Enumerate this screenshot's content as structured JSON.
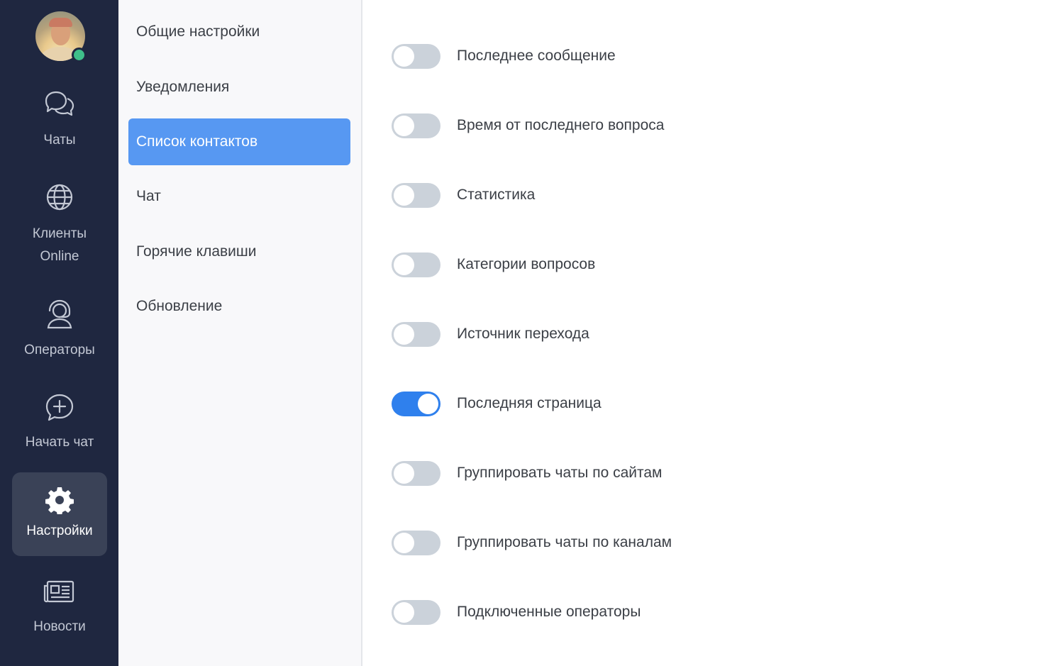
{
  "nav": {
    "status": "online",
    "items": [
      {
        "label": "Чаты",
        "icon": "chat-bubbles-icon"
      },
      {
        "label": "Клиенты Online",
        "line1": "Клиенты",
        "line2": "Online",
        "icon": "globe-icon"
      },
      {
        "label": "Операторы",
        "icon": "operator-headset-icon"
      },
      {
        "label": "Начать чат",
        "icon": "chat-plus-icon"
      },
      {
        "label": "Настройки",
        "icon": "gear-icon",
        "active": true
      },
      {
        "label": "Новости",
        "icon": "newspaper-icon"
      }
    ]
  },
  "settings_menu": {
    "items": [
      {
        "label": "Общие настройки"
      },
      {
        "label": "Уведомления"
      },
      {
        "label": "Список контактов",
        "active": true
      },
      {
        "label": "Чат"
      },
      {
        "label": "Горячие клавиши"
      },
      {
        "label": "Обновление"
      }
    ]
  },
  "contact_list_settings": {
    "toggles": [
      {
        "label": "Последнее сообщение",
        "enabled": false
      },
      {
        "label": "Время от последнего вопроса",
        "enabled": false
      },
      {
        "label": "Статистика",
        "enabled": false
      },
      {
        "label": "Категории вопросов",
        "enabled": false
      },
      {
        "label": "Источник перехода",
        "enabled": false
      },
      {
        "label": "Последняя страница",
        "enabled": true
      },
      {
        "label": "Группировать чаты по сайтам",
        "enabled": false
      },
      {
        "label": "Группировать чаты по каналам",
        "enabled": false
      },
      {
        "label": "Подключенные операторы",
        "enabled": false
      }
    ]
  },
  "colors": {
    "nav_bg": "#1f2740",
    "nav_active_bg": "#3a4257",
    "submenu_active": "#5798f2",
    "toggle_on": "#2f80ed",
    "toggle_off": "#cbd2da",
    "online": "#3fbf8a"
  }
}
